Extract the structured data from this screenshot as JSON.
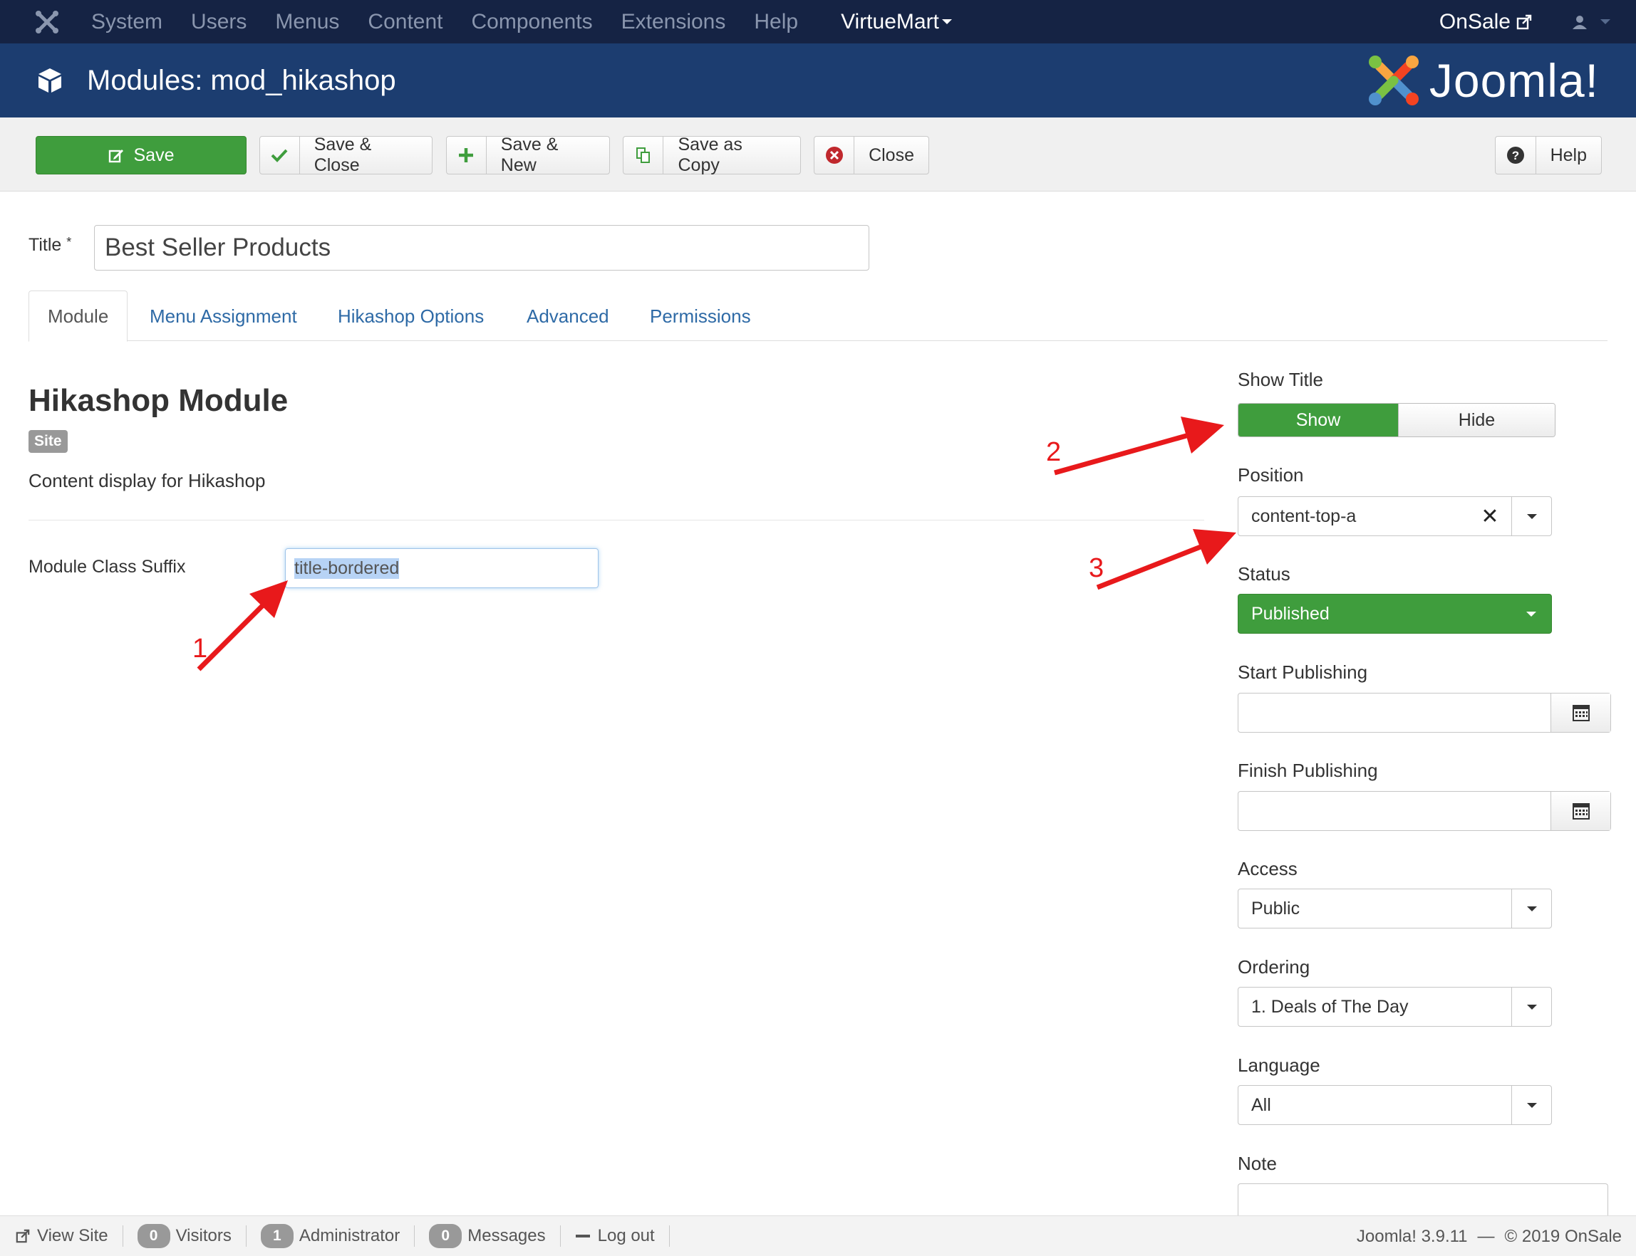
{
  "topnav": {
    "menu": [
      "System",
      "Users",
      "Menus",
      "Content",
      "Components",
      "Extensions",
      "Help"
    ],
    "virtuemart": "VirtueMart",
    "site_link": "OnSale"
  },
  "header": {
    "page_title": "Modules: mod_hikashop",
    "brand": "Joomla!"
  },
  "toolbar": {
    "save": "Save",
    "save_close": "Save & Close",
    "save_new": "Save & New",
    "save_copy": "Save as Copy",
    "close": "Close",
    "help": "Help"
  },
  "form": {
    "title_label": "Title",
    "required_mark": "*",
    "title_value": "Best Seller Products"
  },
  "tabs": [
    "Module",
    "Menu Assignment",
    "Hikashop Options",
    "Advanced",
    "Permissions"
  ],
  "module": {
    "heading": "Hikashop Module",
    "badge": "Site",
    "description": "Content display for Hikashop",
    "class_suffix_label": "Module Class Suffix",
    "class_suffix_value": "title-bordered"
  },
  "sidebar": {
    "show_title_label": "Show Title",
    "show_option": "Show",
    "hide_option": "Hide",
    "position_label": "Position",
    "position_value": "content-top-a",
    "status_label": "Status",
    "status_value": "Published",
    "start_label": "Start Publishing",
    "finish_label": "Finish Publishing",
    "access_label": "Access",
    "access_value": "Public",
    "ordering_label": "Ordering",
    "ordering_value": "1. Deals of The Day",
    "language_label": "Language",
    "language_value": "All",
    "note_label": "Note"
  },
  "annotations": [
    "1",
    "2",
    "3"
  ],
  "statusbar": {
    "view_site": "View Site",
    "visitors_count": "0",
    "visitors": "Visitors",
    "admin_count": "1",
    "admin": "Administrator",
    "messages_count": "0",
    "messages": "Messages",
    "logout": "Log out",
    "version": "Joomla! 3.9.11",
    "copyright": "© 2019 OnSale"
  },
  "colors": {
    "nav_bg": "#152344",
    "header_bg": "#1c3d70",
    "success": "#3f9d3d",
    "link": "#2e6aa6",
    "annotation": "#e8191b"
  }
}
